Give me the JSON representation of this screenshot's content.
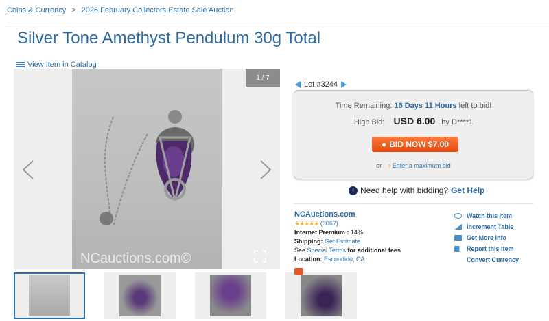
{
  "breadcrumb": {
    "category": "Coins & Currency",
    "sep": ">",
    "auction": "2026 February Collectors Estate Sale Auction"
  },
  "title": "Silver Tone Amethyst Pendulum 30g Total",
  "catalog_link": "View Item in Catalog",
  "viewer": {
    "counter": "1 / 7",
    "watermark": "NCauctions.com©"
  },
  "thumbs_count": 4,
  "lot": {
    "label": "Lot #3244"
  },
  "bid": {
    "time_prefix": "Time Remaining:",
    "time_value": "16 Days 11 Hours",
    "time_suffix": "left to bid!",
    "high_bid_label": "High Bid:",
    "high_bid_value": "USD 6.00",
    "high_bid_by": "by D****1",
    "button": "BID NOW $7.00",
    "or": "or",
    "max_bid": "Enter a maximum bid"
  },
  "help": {
    "text": "Need help with bidding?",
    "link": "Get Help"
  },
  "seller": {
    "name": "NCAuctions.com",
    "stars": "★★★★★",
    "rating_count": "(3067)",
    "premium_label": "Internet Premium :",
    "premium_value": "14%",
    "shipping_label": "Shipping:",
    "shipping_value": "Get Estimate",
    "terms_prefix": "See",
    "terms_link": "Special Terms",
    "terms_suffix": "for additional fees",
    "location_label": "Location:",
    "location_value": "Escondido, CA"
  },
  "actions": {
    "watch": "Watch this Item",
    "increment": "Increment Table",
    "more_info": "Get More Info",
    "report": "Report this Item",
    "convert": "Convert Currency"
  },
  "colors": {
    "accent": "#2b6aa2",
    "bid_button": "#e14a10"
  }
}
